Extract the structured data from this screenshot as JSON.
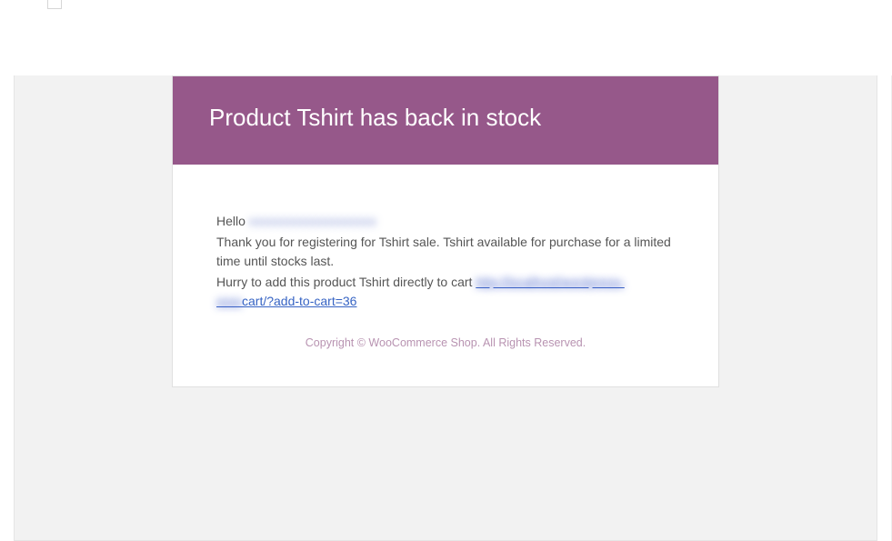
{
  "email": {
    "header_title": "Product Tshirt has back in stock",
    "greeting_prefix": "Hello ",
    "recipient_masked": "xxxxxxxxxxxxxxxxxxxx",
    "body_text": "Thank you for registering for Tshirt sale. Tshirt available for purchase for a limited time until stocks last.",
    "hurry_prefix": "Hurry to add this product Tshirt directly to cart ",
    "link_masked_part": "http://localhost/wordpress-",
    "link_masked_part2": "xxxx",
    "link_visible_part": "cart/?add-to-cart=36",
    "footer": "Copyright © WooCommerce Shop. All Rights Reserved."
  },
  "colors": {
    "header_bg": "#96588a",
    "link": "#3764c4",
    "footer_text": "#b893b1"
  }
}
